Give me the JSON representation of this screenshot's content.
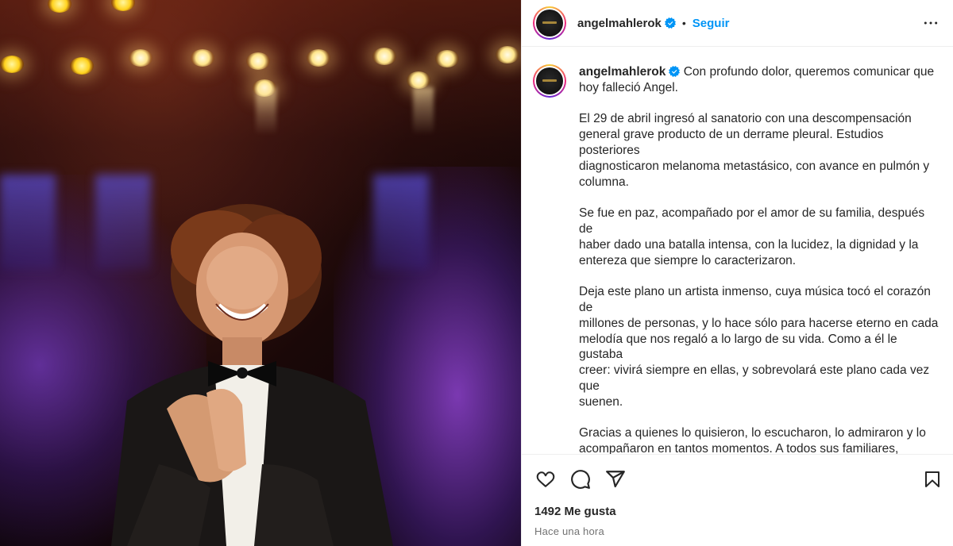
{
  "post": {
    "photo_alt": "Concert photo",
    "author": {
      "username": "angelmahlerok",
      "verified": true
    },
    "header": {
      "separator": "•",
      "follow_label": "Seguir",
      "more_icon": "more-horizontal-icon"
    },
    "caption": {
      "username": "angelmahlerok",
      "text": " Con profundo dolor, queremos comunicar que\nhoy falleció Angel.\n\nEl 29 de abril ingresó al sanatorio con una descompensación\ngeneral grave producto de un derrame pleural. Estudios posteriores\ndiagnosticaron melanoma metastásico, con avance en pulmón y\ncolumna.\n\nSe fue en paz, acompañado por el amor de su familia, después de\nhaber dado una batalla intensa, con la lucidez, la dignidad y la\nentereza que siempre lo caracterizaron.\n\nDeja este plano un artista inmenso, cuya música tocó el corazón de\nmillones de personas, y lo hace sólo para hacerse eterno en cada\nmelodía que nos regaló a lo largo de su vida. Como a él le gustaba\ncreer: vivirá siempre en ellas, y sobrevolará este plano cada vez que\nsuenen.\n\nGracias a quienes lo quisieron, lo escucharon, lo admiraron y lo\nacompañaron en tantos momentos. A todos sus familiares, amigos,\nartistas, músicos. A todos los que confiaron en él. A todos los que\ncreyeron en él.\n\nUn agradecimiento especial y profundo a todo el cuerpo médico,\nenfermeros y staff del Sanatorio Finochietto que han hecho lo"
    },
    "actions": {
      "like_icon": "heart-icon",
      "comment_icon": "comment-icon",
      "share_icon": "share-icon",
      "save_icon": "bookmark-icon"
    },
    "likes_label": "1492 Me gusta",
    "timestamp": "Hace una hora",
    "colors": {
      "link_blue": "#0095f6",
      "verified_blue": "#0095f6",
      "text": "#262626",
      "muted": "#737373"
    }
  }
}
